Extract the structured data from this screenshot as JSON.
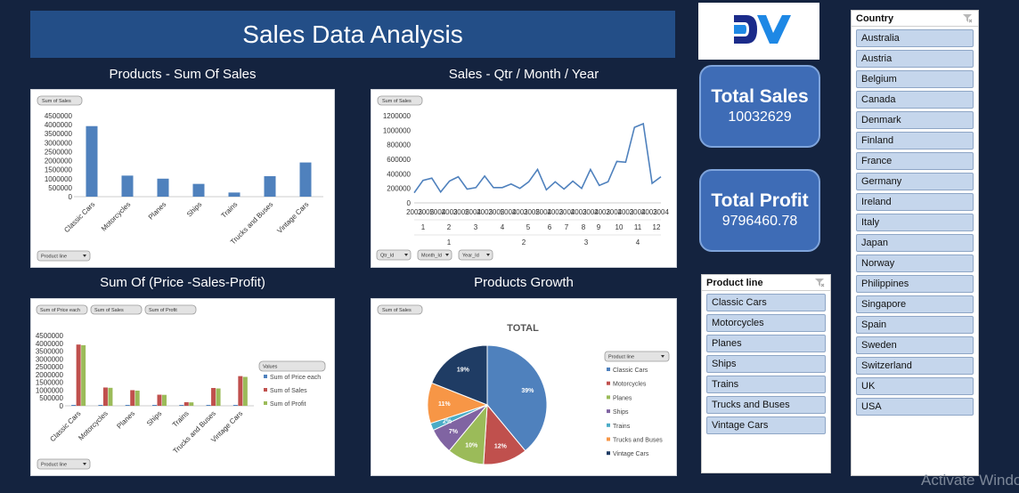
{
  "page_title": "Sales Data Analysis",
  "logo_text": "DV",
  "colors": {
    "bar_blue": "#4f81bd",
    "bar_red": "#c0504d",
    "bar_green": "#9bbb59",
    "background": "#14233f"
  },
  "charts": {
    "products_sales": {
      "title": "Products - Sum Of Sales",
      "field_button": "Sum of Sales",
      "axis_filter": "Product line"
    },
    "sales_time": {
      "title": "Sales - Qtr / Month / Year",
      "field_button": "Sum of Sales",
      "filters": [
        "Qtr_Id",
        "Month_Id",
        "Year_Id"
      ]
    },
    "price_sales_profit": {
      "title": "Sum Of  (Price -Sales-Profit)",
      "field_buttons": [
        "Sum of Price each",
        "Sum of Sales",
        "Sum of Profit"
      ],
      "axis_filter": "Product line",
      "legend_title": "Values"
    },
    "products_growth": {
      "title": "Products Growth",
      "field_button": "Sum of Sales",
      "legend_filter": "Product line"
    }
  },
  "chart_data": [
    {
      "type": "bar",
      "categories": [
        "Classic Cars",
        "Motorcycles",
        "Planes",
        "Ships",
        "Trains",
        "Trucks and Buses",
        "Vintage Cars"
      ],
      "values": [
        3920000,
        1170000,
        1000000,
        710000,
        230000,
        1140000,
        1900000
      ],
      "ylim": [
        0,
        4500000
      ],
      "yticks": [
        "4500000",
        "4000000",
        "3500000",
        "3000000",
        "2500000",
        "2000000",
        "1500000",
        "1000000",
        "500000",
        "0"
      ],
      "grid": false
    },
    {
      "type": "line",
      "values": [
        140000,
        310000,
        340000,
        150000,
        300000,
        360000,
        190000,
        210000,
        370000,
        210000,
        210000,
        260000,
        200000,
        290000,
        460000,
        180000,
        290000,
        190000,
        300000,
        200000,
        460000,
        240000,
        290000,
        570000,
        560000,
        1040000,
        1090000,
        270000,
        360000
      ],
      "ylim": [
        0,
        1200000
      ],
      "yticks": [
        "1200000",
        "1000000",
        "800000",
        "600000",
        "400000",
        "200000",
        "0"
      ],
      "year_labels": [
        "2003",
        "2005",
        "2004",
        "2003",
        "2005",
        "2004",
        "2003",
        "2005",
        "2004",
        "2003",
        "2005",
        "2004",
        "2003",
        "2004",
        "2003",
        "2004",
        "2003",
        "2004",
        "2003",
        "2004",
        "2003",
        "2004"
      ],
      "month_labels": [
        "1",
        "2",
        "3",
        "4",
        "5",
        "6",
        "7",
        "8",
        "9",
        "10",
        "11",
        "12"
      ],
      "quarter_labels": [
        "1",
        "2",
        "3",
        "4"
      ],
      "grid": false
    },
    {
      "type": "bar",
      "categories": [
        "Classic Cars",
        "Motorcycles",
        "Planes",
        "Ships",
        "Trains",
        "Trucks and Buses",
        "Vintage Cars"
      ],
      "series": [
        {
          "name": "Sum of Price each",
          "values": [
            30000,
            40000,
            30000,
            30000,
            40000,
            40000,
            50000
          ]
        },
        {
          "name": "Sum of Sales",
          "values": [
            3920000,
            1170000,
            1000000,
            710000,
            230000,
            1140000,
            1900000
          ]
        },
        {
          "name": "Sum of Profit",
          "values": [
            3880000,
            1150000,
            970000,
            700000,
            220000,
            1110000,
            1850000
          ]
        }
      ],
      "ylim": [
        0,
        4500000
      ],
      "yticks": [
        "4500000",
        "4000000",
        "3500000",
        "3000000",
        "2500000",
        "2000000",
        "1500000",
        "1000000",
        "500000",
        "0"
      ],
      "legend": "right"
    },
    {
      "type": "pie",
      "title": "TOTAL",
      "categories": [
        "Classic Cars",
        "Motorcycles",
        "Planes",
        "Ships",
        "Trains",
        "Trucks and Buses",
        "Vintage Cars"
      ],
      "values": [
        39,
        12,
        10,
        7,
        2,
        11,
        19
      ],
      "labels": [
        "39%",
        "12%",
        "10%",
        "7%",
        "2%",
        "11%",
        "19%"
      ],
      "colors": [
        "#4f81bd",
        "#c0504d",
        "#9bbb59",
        "#8064a2",
        "#4bacc6",
        "#f79646",
        "#1f3c64"
      ],
      "legend": "right"
    }
  ],
  "kpi": {
    "total_sales_label": "Total Sales",
    "total_sales_value": "10032629",
    "total_profit_label": "Total Profit",
    "total_profit_value": "9796460.78"
  },
  "product_slicer": {
    "header": "Product line",
    "items": [
      "Classic Cars",
      "Motorcycles",
      "Planes",
      "Ships",
      "Trains",
      "Trucks and Buses",
      "Vintage Cars"
    ]
  },
  "country_slicer": {
    "header": "Country",
    "items": [
      "Australia",
      "Austria",
      "Belgium",
      "Canada",
      "Denmark",
      "Finland",
      "France",
      "Germany",
      "Ireland",
      "Italy",
      "Japan",
      "Norway",
      "Philippines",
      "Singapore",
      "Spain",
      "Sweden",
      "Switzerland",
      "UK",
      "USA"
    ]
  },
  "watermark": "Activate Windows"
}
